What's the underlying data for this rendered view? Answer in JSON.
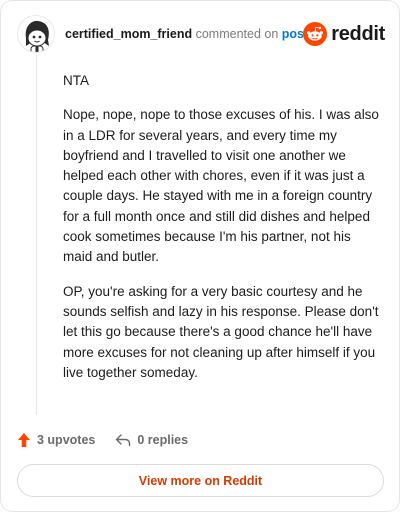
{
  "header": {
    "username": "certified_mom_friend",
    "action_text": "commented on",
    "post_link": "post",
    "brand": "reddit",
    "avatar_icon": "snoo-avatar-icon",
    "logo_icon": "reddit-logo-icon"
  },
  "comment": {
    "paragraphs": [
      "NTA",
      "Nope, nope, nope to those excuses of his. I was also in a LDR for several years, and every time my boyfriend and I travelled to visit one another we helped each other with chores, even if it was just a couple days. He stayed with me in a foreign country for a full month once and still did dishes and helped cook sometimes because I'm his partner, not his maid and butler.",
      "OP, you're asking for a very basic courtesy and he sounds selfish and lazy in his response. Please don't let this go because there's a good chance he'll have more excuses for not cleaning up after himself if you live together someday."
    ]
  },
  "footer": {
    "upvotes": "3 upvotes",
    "replies": "0 replies",
    "upvote_icon": "upvote-arrow-icon",
    "reply_icon": "reply-icon"
  },
  "view_button": "View more on Reddit",
  "colors": {
    "brand_orange": "#ff4500",
    "link_blue": "#0079d3",
    "button_text": "#d93a00"
  }
}
